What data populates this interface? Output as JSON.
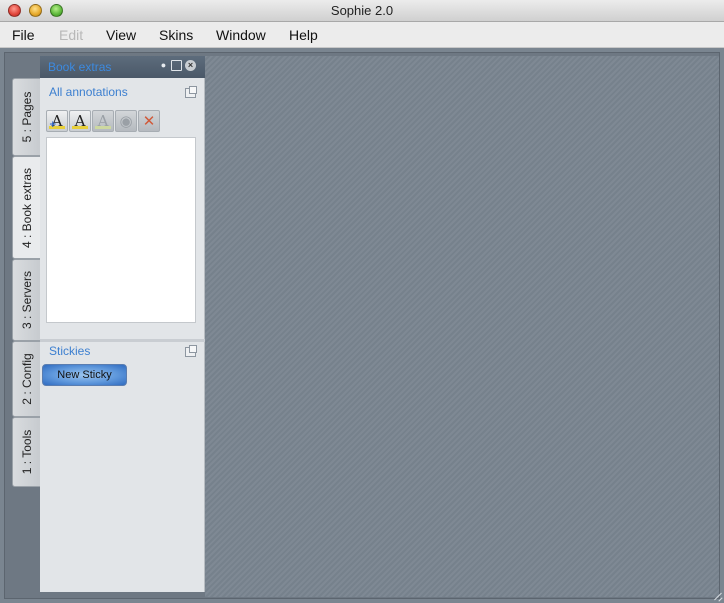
{
  "window": {
    "title": "Sophie 2.0"
  },
  "menu": [
    "File",
    "Edit",
    "View",
    "Skins",
    "Window",
    "Help"
  ],
  "vertical_tabs": [
    {
      "label": "5 : Pages",
      "active": false
    },
    {
      "label": "4 : Book extras",
      "active": true
    },
    {
      "label": "3 : Servers",
      "active": false
    },
    {
      "label": "2 : Config",
      "active": false
    },
    {
      "label": "1 : Tools",
      "active": false
    }
  ],
  "panel": {
    "title": "Book extras",
    "header_icons": [
      "pin-icon",
      "float-icon",
      "close-icon"
    ],
    "annotations": {
      "title": "All annotations",
      "toolbar": [
        {
          "icon": "add-annotation-icon",
          "glyph": "A"
        },
        {
          "icon": "highlight-annotation-icon",
          "glyph": "A"
        },
        {
          "icon": "edit-annotation-icon",
          "glyph": "A"
        },
        {
          "icon": "toggle-visibility-icon",
          "glyph": "◉"
        },
        {
          "icon": "delete-annotation-icon",
          "glyph": "✕"
        }
      ]
    },
    "stickies": {
      "title": "Stickies",
      "new_button": "New Sticky"
    }
  },
  "colors": {
    "workspace": "#7a8590",
    "panel_background": "#e2e5e8",
    "panel_header": "#4a5868",
    "section_title": "#3c7fd0",
    "sticky_button": "#5f98dc"
  }
}
